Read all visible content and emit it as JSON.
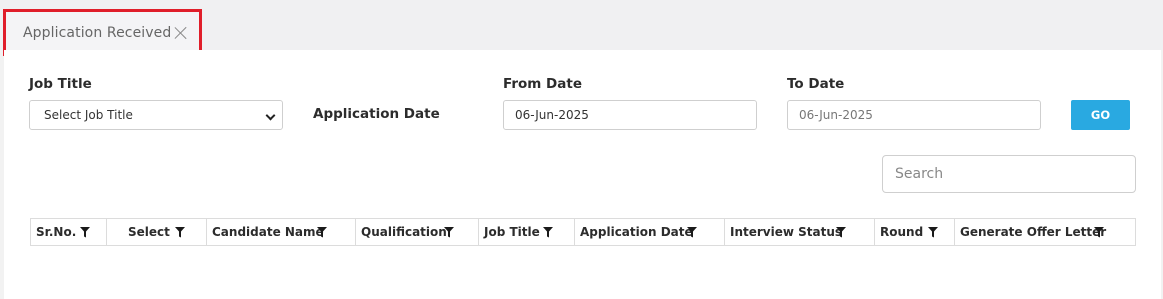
{
  "tab": {
    "label": "Application Received"
  },
  "filters": {
    "job_title_label": "Job Title",
    "job_title_selected": "Select Job Title",
    "application_date_label": "Application Date",
    "from_date_label": "From Date",
    "from_date_value": "06-Jun-2025",
    "to_date_label": "To Date",
    "to_date_placeholder": "06-Jun-2025",
    "go_label": "GO"
  },
  "search": {
    "placeholder": "Search"
  },
  "table": {
    "columns": [
      "Sr.No.",
      "Select",
      "Candidate Name",
      "Qualification",
      "Job Title",
      "Application Date",
      "Interview Status",
      "Round",
      "Generate Offer Letter"
    ]
  },
  "colors": {
    "accent": "#29a9e1",
    "tab_highlight": "#e01e2a"
  },
  "icons": {
    "tab_close": "close-icon",
    "dropdown": "chevron-down-icon",
    "column_filter": "filter-icon"
  }
}
